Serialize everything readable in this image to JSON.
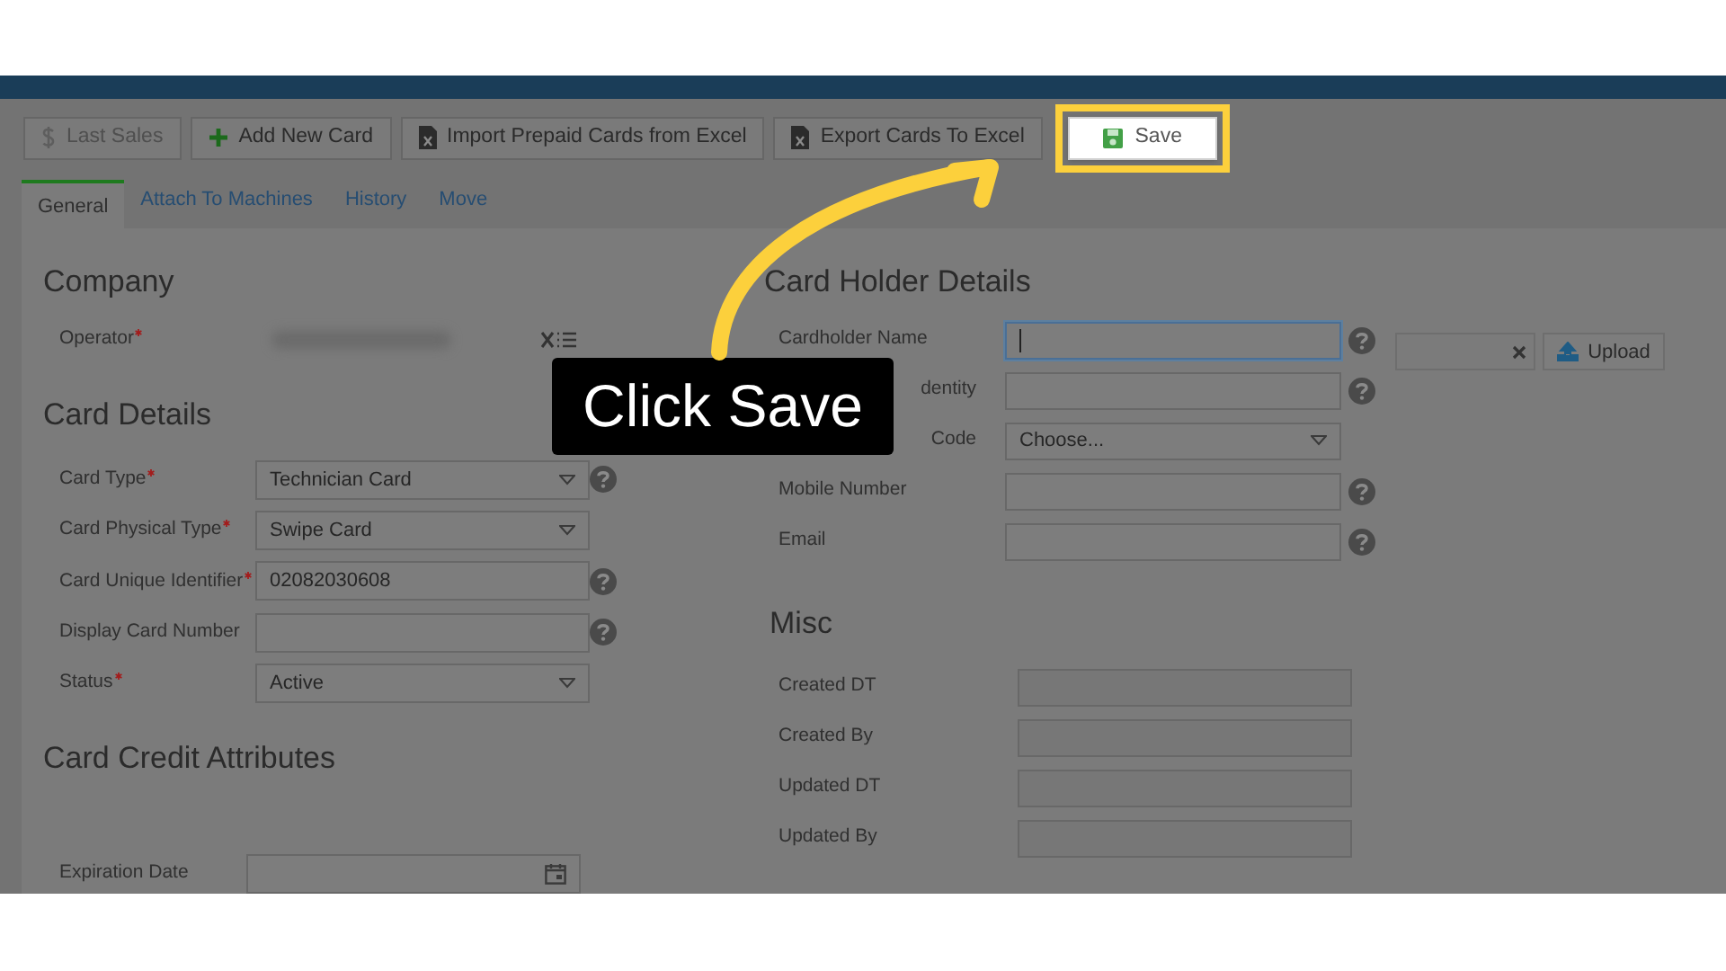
{
  "toolbar": [
    {
      "label": "Last Sales",
      "kind": "dollar",
      "disabled": true,
      "highlighted": false
    },
    {
      "label": "Add New Card",
      "kind": "plus",
      "disabled": false,
      "highlighted": false
    },
    {
      "label": "Import Prepaid Cards from Excel",
      "kind": "excel",
      "disabled": false,
      "highlighted": false
    },
    {
      "label": "Export Cards To Excel",
      "kind": "excel",
      "disabled": false,
      "highlighted": false
    },
    {
      "label": "Save",
      "kind": "save",
      "disabled": false,
      "highlighted": true
    }
  ],
  "tabs": [
    {
      "label": "General",
      "selected": true
    },
    {
      "label": "Attach To Machines",
      "selected": false
    },
    {
      "label": "History",
      "selected": false
    },
    {
      "label": "Move",
      "selected": false
    }
  ],
  "left_sections": [
    {
      "title": "Company",
      "fields": [
        {
          "label": "Operator",
          "required": true,
          "kind": "redacted"
        }
      ]
    },
    {
      "title": "Card Details",
      "fields": [
        {
          "label": "Card Type",
          "required": true,
          "kind": "select",
          "value": "Technician Card",
          "help": true
        },
        {
          "label": "Card Physical Type",
          "required": true,
          "kind": "select",
          "value": "Swipe Card",
          "help": false
        },
        {
          "label": "Card Unique Identifier",
          "required": true,
          "kind": "text",
          "value": "02082030608",
          "help": true
        },
        {
          "label": "Display Card Number",
          "required": false,
          "kind": "text",
          "help": true
        },
        {
          "label": "Status",
          "required": true,
          "kind": "select",
          "value": "Active",
          "help": false
        }
      ]
    },
    {
      "title": "Card Credit Attributes",
      "fields": [
        {
          "label": "Expiration Date",
          "required": false,
          "kind": "date",
          "help": false
        }
      ]
    }
  ],
  "card_holder": {
    "title": "Card Holder Details",
    "fields": [
      {
        "label": "Cardholder Name",
        "kind": "text",
        "focused": true,
        "cut": false,
        "help": true
      },
      {
        "label": "dentity",
        "kind": "text",
        "focused": false,
        "cut": true,
        "help": true
      },
      {
        "label": "Code",
        "kind": "select",
        "value": "Choose...",
        "focused": false,
        "cut": true,
        "help": false
      },
      {
        "label": "Mobile Number",
        "kind": "text",
        "focused": false,
        "cut": false,
        "help": true
      },
      {
        "label": "Email",
        "kind": "text",
        "focused": false,
        "cut": false,
        "help": true
      }
    ]
  },
  "upload": {
    "label": "Upload"
  },
  "misc": {
    "title": "Misc",
    "fields": [
      {
        "label": "Created DT"
      },
      {
        "label": "Created By"
      },
      {
        "label": "Updated DT"
      },
      {
        "label": "Updated By"
      }
    ]
  },
  "callout": {
    "text": "Click Save"
  }
}
